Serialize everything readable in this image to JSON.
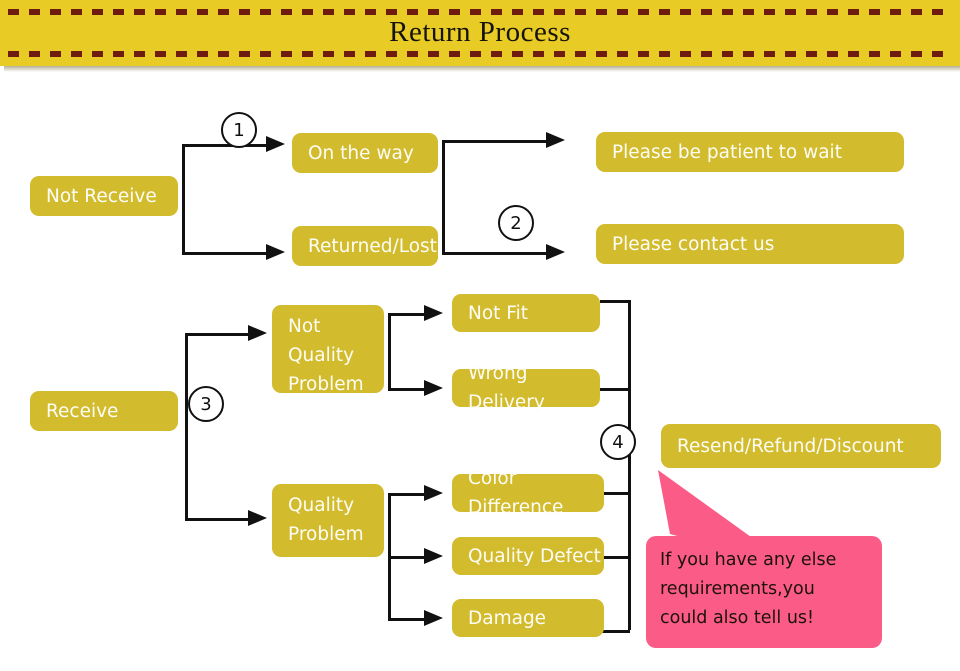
{
  "header": {
    "title": "Return Process",
    "banner_color": "#e9cb26",
    "dash_color": "#6e1b10"
  },
  "theme": {
    "node_fill": "#d3bb2e",
    "node_text": "#fdfdf6",
    "connector": "#111111",
    "callout_fill": "#fa5b87",
    "callout_text": "#1d1208",
    "page_background": "#ffffff"
  },
  "flow": {
    "branch_not_receive": {
      "root": "Not Receive",
      "step_marker": "1",
      "states": [
        "On the way",
        "Returned/Lost"
      ],
      "step_marker_2": "2",
      "outcomes": [
        "Please be patient to wait",
        "Please contact us"
      ]
    },
    "branch_receive": {
      "root": "Receive",
      "step_marker": "3",
      "categories": [
        "Not Quality Problem",
        "Quality Problem"
      ],
      "not_quality_reasons": [
        "Not Fit",
        "Wrong Delivery"
      ],
      "quality_reasons": [
        "Color Difference",
        "Quality Defect",
        "Damage"
      ],
      "step_marker_4": "4",
      "resolution": "Resend/Refund/Discount"
    }
  },
  "callout": {
    "line1": "If you have any else",
    "line2": "requirements,you",
    "line3": "could also tell us!"
  },
  "node_labels": {
    "not_receive": "Not Receive",
    "on_the_way": "On the way",
    "returned_lost": "Returned/Lost",
    "be_patient": "Please be patient to wait",
    "contact_us": "Please contact us",
    "receive": "Receive",
    "not_quality_l1": "Not",
    "not_quality_l2": "Quality",
    "not_quality_l3": "Problem",
    "quality_l1": "Quality",
    "quality_l2": "Problem",
    "not_fit": "Not Fit",
    "wrong_delivery": "Wrong Delivery",
    "color_difference": "Color Difference",
    "quality_defect": "Quality Defect",
    "damage": "Damage",
    "resend_refund_discount": "Resend/Refund/Discount"
  },
  "markers": {
    "one": "1",
    "two": "2",
    "three": "3",
    "four": "4"
  }
}
